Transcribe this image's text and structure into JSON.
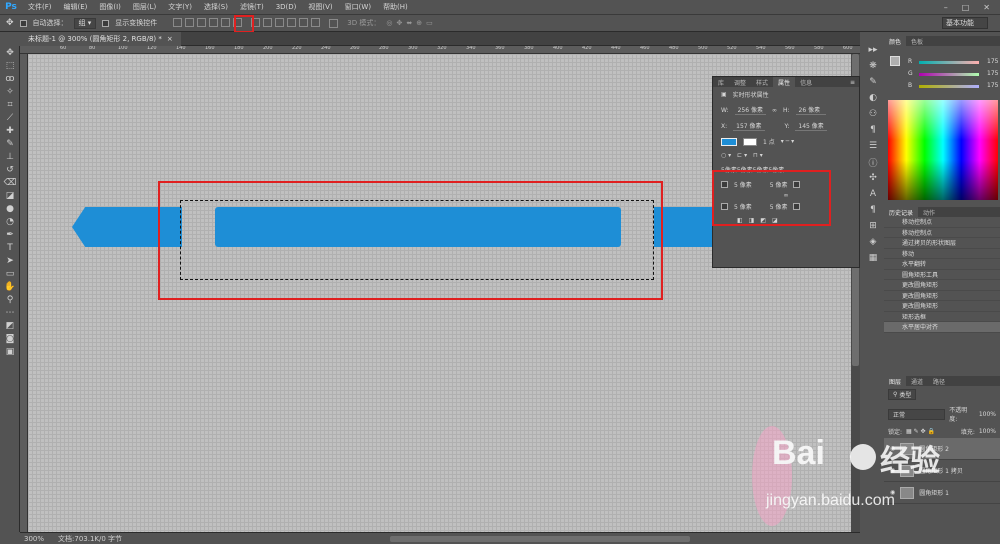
{
  "app": {
    "logo": "Ps"
  },
  "menu": [
    "文件(F)",
    "编辑(E)",
    "图像(I)",
    "图层(L)",
    "文字(Y)",
    "选择(S)",
    "滤镜(T)",
    "3D(D)",
    "视图(V)",
    "窗口(W)",
    "帮助(H)"
  ],
  "options": {
    "auto_select_label": "自动选择：",
    "auto_select_value": "组",
    "show_transform_label": "显示变换控件",
    "mode_3d_label": "3D 模式：",
    "workspace": "基本功能"
  },
  "document": {
    "tab_title": "未标题-1 @ 300% (圆角矩形 2, RGB/8) *",
    "close": "×"
  },
  "ruler_ticks": [
    "60",
    "80",
    "100",
    "120",
    "140",
    "160",
    "180",
    "200",
    "220",
    "240",
    "260",
    "280",
    "300",
    "320",
    "340",
    "360",
    "380",
    "400",
    "420",
    "440",
    "460",
    "480",
    "500",
    "520",
    "540",
    "560",
    "580",
    "600"
  ],
  "status": {
    "zoom": "300%",
    "doc_info": "文档:703.1K/0 字节"
  },
  "properties": {
    "tabs": [
      "库",
      "调整",
      "样式",
      "属性",
      "信息"
    ],
    "active_tab": "属性",
    "title": "实时形状属性",
    "w_label": "W:",
    "w_value": "256 像素",
    "h_label": "H:",
    "h_value": "26 像素",
    "x_label": "X:",
    "x_value": "157 像素",
    "y_label": "Y:",
    "y_value": "145 像素",
    "stroke_width": "1 点",
    "corner_header": "5像素5像素5像素5像素",
    "corner_tl": "5 像素",
    "corner_tr": "5 像素",
    "corner_bl": "5 像素",
    "corner_br": "5 像素",
    "link_symbol": "∞"
  },
  "color": {
    "tabs": [
      "颜色",
      "色板"
    ],
    "r_label": "R",
    "r_value": "175",
    "g_label": "G",
    "g_value": "175",
    "b_label": "B",
    "b_value": "175",
    "accent": "#1e8ed6"
  },
  "history": {
    "tabs": [
      "历史记录",
      "动作"
    ],
    "items": [
      "移动控制点",
      "移动控制点",
      "通过拷贝的形状图层",
      "移动",
      "水平翻转",
      "圆角矩形工具",
      "更改圆角矩形",
      "更改圆角矩形",
      "更改圆角矩形",
      "矩形选框",
      "水平居中对齐"
    ],
    "active_index": 10
  },
  "layers": {
    "tabs": [
      "图层",
      "通道",
      "路径"
    ],
    "kind_label": "类型",
    "blend_mode": "正常",
    "opacity_label": "不透明度:",
    "opacity_value": "100%",
    "lock_label": "锁定:",
    "fill_label": "填充:",
    "fill_value": "100%",
    "items": [
      "圆角矩形 2",
      "圆角矩形 1 拷贝",
      "圆角矩形 1"
    ],
    "active_index": 0
  },
  "watermark": {
    "brand": "Bai",
    "brand2": "经验",
    "url": "jingyan.baidu.com"
  }
}
